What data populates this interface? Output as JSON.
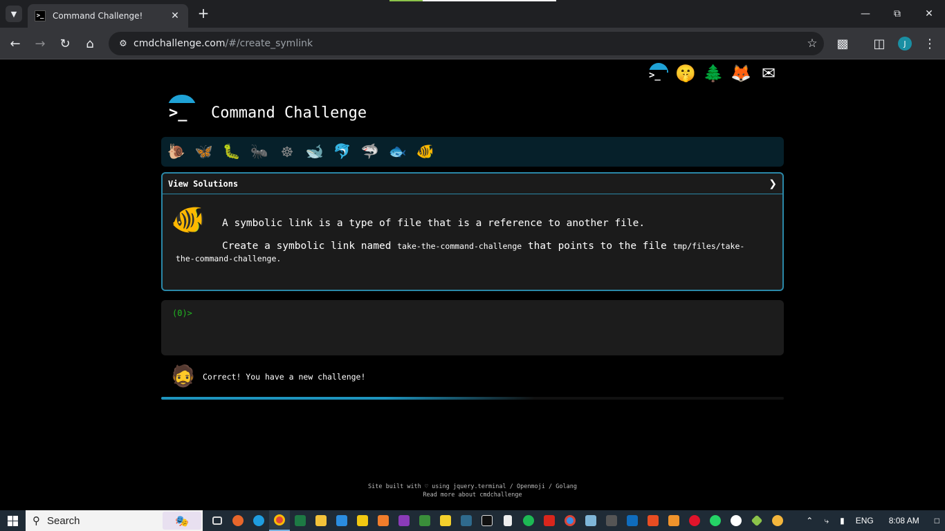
{
  "browser": {
    "tab_title": "Command Challenge!",
    "url_host": "cmdchallenge.com",
    "url_path": "/#/create_symlink",
    "profile_initial": "J"
  },
  "site": {
    "title": "Command Challenge",
    "view_solutions_label": "View Solutions",
    "challenge_description": "A symbolic link is a type of file that is a reference to another file.",
    "task_prefix": "Create a symbolic link named",
    "link_name": "take-the-command-challenge",
    "task_middle": "that points to the file",
    "target_path": "tmp/files/take-the-command-challenge",
    "task_suffix": ".",
    "prompt": "(0)>",
    "feedback": "Correct! You have a new challenge!",
    "progress_fraction": 0.6,
    "footer_line1": "Site built with ♡ using jquery.terminal / Openmoji / Golang",
    "footer_line2": "Read more about cmdchallenge"
  },
  "top_icons": [
    "terminal-logo-icon",
    "shushing-face-icon",
    "tree-icon",
    "gitlab-icon",
    "envelope-icon"
  ],
  "level_icons": [
    "snail-icon",
    "butterfly-icon",
    "caterpillar-icon",
    "ant-icon",
    "wheel-icon",
    "whale-icon",
    "dolphin-icon",
    "shark-icon",
    "fish-icon",
    "tropical-fish-icon"
  ],
  "taskbar": {
    "search_label": "Search",
    "language": "ENG",
    "time": "8:08 AM"
  }
}
